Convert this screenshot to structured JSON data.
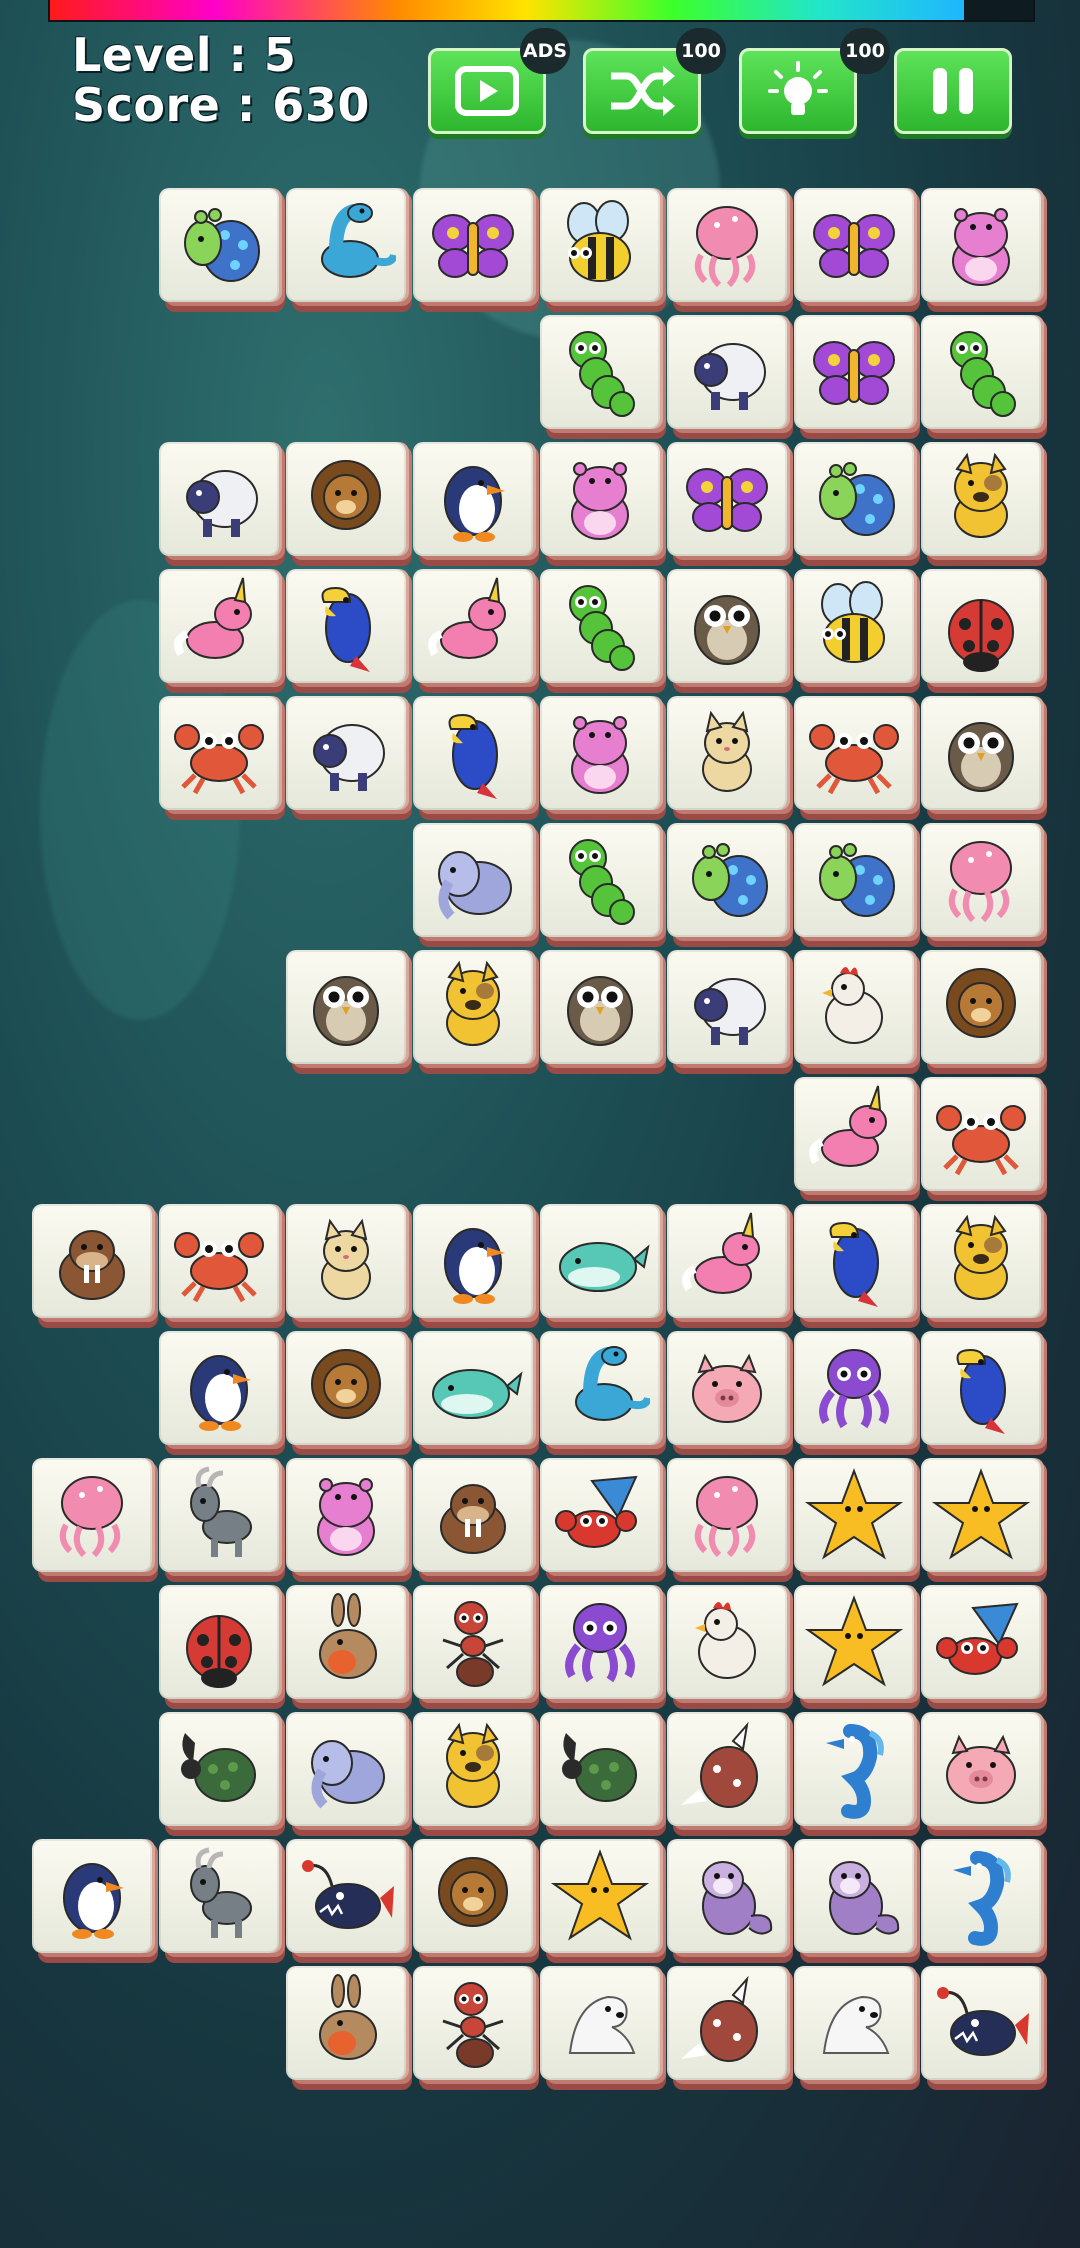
{
  "hud": {
    "level_text": "Level : 5",
    "score_text": "Score : 630",
    "timer_fraction": 0.93,
    "buttons": [
      {
        "name": "watch-ad-button",
        "icon": "play-video-icon",
        "badge": "ADS"
      },
      {
        "name": "shuffle-button",
        "icon": "shuffle-icon",
        "badge": "100"
      },
      {
        "name": "hint-button",
        "icon": "lightbulb-icon",
        "badge": "100"
      },
      {
        "name": "pause-button",
        "icon": "pause-icon",
        "badge": ""
      }
    ]
  },
  "board": {
    "columns": 8,
    "rows": [
      [
        "",
        "peacock",
        "dino",
        "butterfly",
        "bee",
        "jelly",
        "butterfly",
        "hippo"
      ],
      [
        "",
        "",
        "",
        "",
        "caterpillar",
        "sheep",
        "butterfly",
        "caterpillar"
      ],
      [
        "",
        "sheep",
        "lion",
        "penguin",
        "hippo",
        "butterfly",
        "peacock",
        "dog"
      ],
      [
        "",
        "unicorn",
        "parrot",
        "unicorn",
        "caterpillar",
        "owl",
        "bee",
        "ladybug"
      ],
      [
        "",
        "crab",
        "sheep",
        "parrot",
        "hippo",
        "cat",
        "crab",
        "owl"
      ],
      [
        "",
        "",
        "",
        "elephant",
        "caterpillar",
        "peacock",
        "peacock",
        "jelly"
      ],
      [
        "",
        "",
        "owl",
        "dog",
        "owl",
        "sheep",
        "chicken",
        "lion"
      ],
      [
        "",
        "",
        "",
        "",
        "",
        "",
        "unicorn",
        "crab"
      ],
      [
        "walrus",
        "crab",
        "cat",
        "penguin",
        "whale",
        "unicorn",
        "parrot",
        "dog"
      ],
      [
        "",
        "penguin",
        "lion",
        "whale",
        "dino",
        "pig",
        "octopus",
        "parrot"
      ],
      [
        "jelly",
        "goat",
        "hippo",
        "walrus",
        "hermit",
        "jelly",
        "starfish",
        "starfish"
      ],
      [
        "",
        "ladybug",
        "rabbit",
        "ant",
        "octopus",
        "chicken",
        "starfish",
        "hermit"
      ],
      [
        "",
        "beetle",
        "elephant",
        "dog",
        "beetle",
        "walrusred",
        "seahorse",
        "pig"
      ],
      [
        "penguin",
        "goat",
        "angler",
        "lion",
        "starfish",
        "beaver",
        "beaver",
        "seahorse"
      ],
      [
        "",
        "",
        "rabbit",
        "ant",
        "seal",
        "walrusred",
        "seal",
        "angler"
      ]
    ]
  },
  "colors": {
    "peacock": "#3f73c9",
    "dino": "#3aa7d6",
    "butterfly": "#a24ad6",
    "bee": "#f2cf2e",
    "jelly": "#f28bb0",
    "hippo": "#e77fd0",
    "caterpillar": "#55c43a",
    "sheep": "#3b3d78",
    "lion": "#b77a36",
    "penguin": "#2a3a78",
    "dog": "#f1c232",
    "unicorn": "#f27fb0",
    "parrot": "#2b4bc7",
    "owl": "#6a5a48",
    "ladybug": "#d63a35",
    "crab": "#e0573a",
    "cat": "#eed8a2",
    "elephant": "#9ea6dc",
    "chicken": "#f3efe6",
    "walrus": "#8a5634",
    "whale": "#57c7b6",
    "pig": "#f4a9b5",
    "octopus": "#8b4bd1",
    "goat": "#767f85",
    "hermit": "#d9382f",
    "starfish": "#f7bd22",
    "rabbit": "#b58a5f",
    "ant": "#c8453a",
    "beetle": "#3b6b3a",
    "walrusred": "#a0483b",
    "seahorse": "#2e7fd0",
    "angler": "#252e57",
    "beaver": "#a07fc7",
    "seal": "#f6f6f6"
  }
}
